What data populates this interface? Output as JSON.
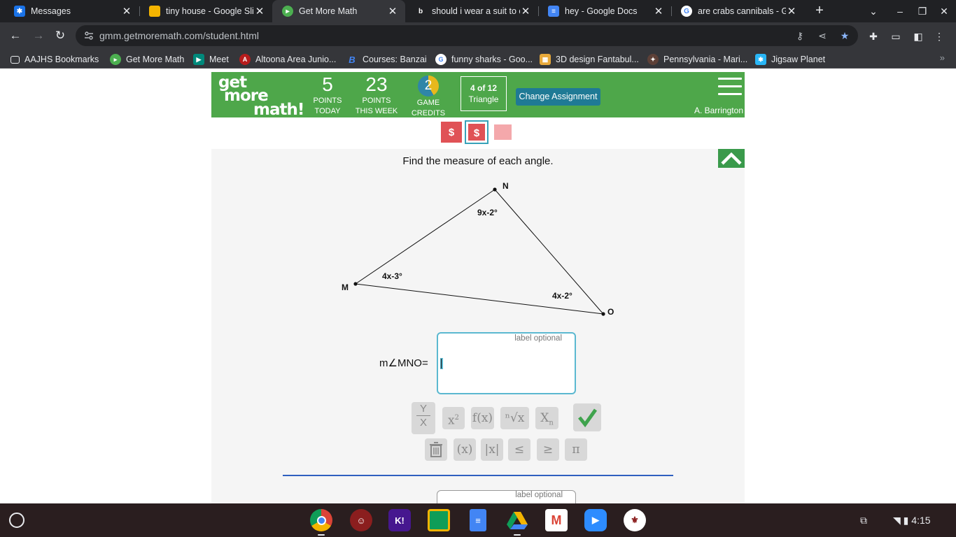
{
  "browser": {
    "tabs": [
      {
        "title": "Messages",
        "icon": "messages-icon",
        "color": "#1a73e8"
      },
      {
        "title": "tiny house - Google Slid",
        "icon": "slides-icon",
        "color": "#f4b400"
      },
      {
        "title": "Get More Math",
        "icon": "gmm-icon",
        "color": "#4caf50"
      },
      {
        "title": "should i wear a suit to c",
        "icon": "bing-icon",
        "color": "#202124"
      },
      {
        "title": "hey - Google Docs",
        "icon": "docs-icon",
        "color": "#4285f4"
      },
      {
        "title": "are crabs cannibals - G",
        "icon": "google-icon",
        "color": "#ffffff"
      }
    ],
    "new_tab": "+",
    "url": "gmm.getmoremath.com/student.html"
  },
  "bookmarks": [
    {
      "label": "AAJHS Bookmarks",
      "icon": "folder-icon"
    },
    {
      "label": "Get More Math",
      "icon": "gmm-icon"
    },
    {
      "label": "Meet",
      "icon": "meet-icon"
    },
    {
      "label": "Altoona Area Junio...",
      "icon": "school-icon"
    },
    {
      "label": "Courses: Banzai",
      "icon": "banzai-icon"
    },
    {
      "label": "funny sharks - Goo...",
      "icon": "google-icon"
    },
    {
      "label": "3D design Fantabul...",
      "icon": "tinkercad-icon"
    },
    {
      "label": "Pennsylvania - Mari...",
      "icon": "marines-icon"
    },
    {
      "label": "Jigsaw Planet",
      "icon": "jigsaw-icon"
    }
  ],
  "header": {
    "logo": [
      "get",
      "more",
      "math!"
    ],
    "points_today": {
      "value": "5",
      "label1": "POINTS",
      "label2": "TODAY"
    },
    "points_week": {
      "value": "23",
      "label1": "POINTS",
      "label2": "THIS WEEK"
    },
    "credits": {
      "value": "2",
      "label1": "GAME",
      "label2": "CREDITS"
    },
    "progress": {
      "count": "4 of 12",
      "topic": "Triangle"
    },
    "change_button": "Change Assignment",
    "username": "A. Barrington"
  },
  "markers": [
    "$",
    "$",
    ""
  ],
  "question": {
    "prompt": "Find the measure of each angle.",
    "vertices": {
      "n": "N",
      "m": "M",
      "o": "O"
    },
    "angles": {
      "n": "9x-2°",
      "m": "4x-3°",
      "o": "4x-2°"
    },
    "answer_label": "m∠MNO=",
    "optional": "label optional"
  },
  "keyboard": {
    "row1": [
      "Y/X",
      "x²",
      "f(x)",
      "ⁿ√x",
      "Xₙ"
    ],
    "row2": [
      "trash",
      "(x)",
      "|x|",
      "≤",
      "≥",
      "π"
    ],
    "frac_top": "Y",
    "frac_bottom": "X",
    "pow": "x",
    "pow_sup": "2",
    "fx": "f(x)",
    "root": "ⁿ√x",
    "sub": "X",
    "sub_n": "n",
    "paren": "(x)",
    "abs": "|x|",
    "le": "≤",
    "ge": "≥",
    "pi": "π"
  },
  "second_answer_optional": "label optional",
  "shelf": {
    "time": "4:15",
    "apps": [
      "chrome-icon",
      "app-icon",
      "kahoot-icon",
      "classroom-icon",
      "docs-icon",
      "drive-icon",
      "gmail-icon",
      "zoom-icon",
      "school-icon"
    ],
    "kahoot": "K!"
  }
}
